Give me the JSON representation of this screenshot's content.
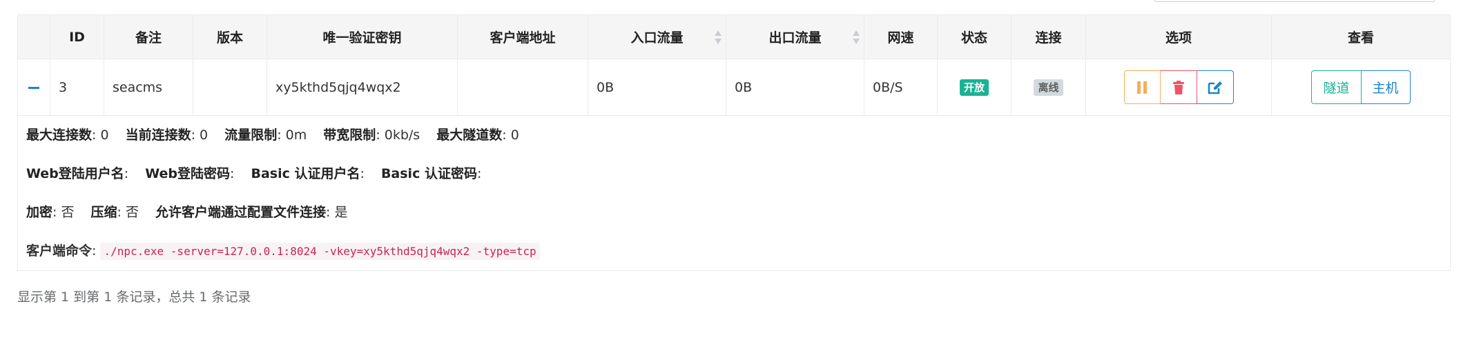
{
  "table": {
    "columns": [
      "",
      "ID",
      "备注",
      "版本",
      "唯一验证密钥",
      "客户端地址",
      "入口流量",
      "出口流量",
      "网速",
      "状态",
      "连接",
      "选项",
      "查看"
    ],
    "row": {
      "id": "3",
      "remark": "seacms",
      "version": "",
      "vkey": "xy5kthd5qjq4wqx2",
      "client_addr": "",
      "in_flow": "0B",
      "out_flow": "0B",
      "speed": "0B/S",
      "status": "开放",
      "connection": "离线",
      "view_tunnel": "隧道",
      "view_host": "主机"
    },
    "detail": {
      "max_conn_label": "最大连接数",
      "max_conn": ": 0",
      "cur_conn_label": "当前连接数",
      "cur_conn": ": 0",
      "flow_limit_label": "流量限制",
      "flow_limit": ": 0m",
      "rate_limit_label": "带宽限制",
      "rate_limit": ": 0kb/s",
      "max_tunnel_label": "最大隧道数",
      "max_tunnel": ": 0",
      "web_user_label": "Web登陆用户名",
      "web_user": ":",
      "web_pass_label": "Web登陆密码",
      "web_pass": ":",
      "basic_user_label": "Basic 认证用户名",
      "basic_user": ":",
      "basic_pass_label": "Basic 认证密码",
      "basic_pass": ":",
      "crypt_label": "加密",
      "crypt": ": 否",
      "compress_label": "压缩",
      "compress": ": 否",
      "config_conn_label": "允许客户端通过配置文件连接",
      "config_conn": ": 是",
      "cmd_label": "客户端命令",
      "cmd_sep": ": ",
      "cmd": "./npc.exe -server=127.0.0.1:8024 -vkey=xy5kthd5qjq4wqx2 -type=tcp"
    }
  },
  "footer": {
    "summary": "显示第 1 到第 1 条记录，总共 1 条记录"
  },
  "icons": {
    "pause": "pause-icon",
    "delete": "trash-icon",
    "edit": "edit-icon",
    "collapse": "minus-icon"
  },
  "colors": {
    "open": "#1ab394",
    "offline": "#d1dade",
    "warning": "#f8ac59",
    "danger": "#ed5565",
    "info": "#1c84c6"
  }
}
